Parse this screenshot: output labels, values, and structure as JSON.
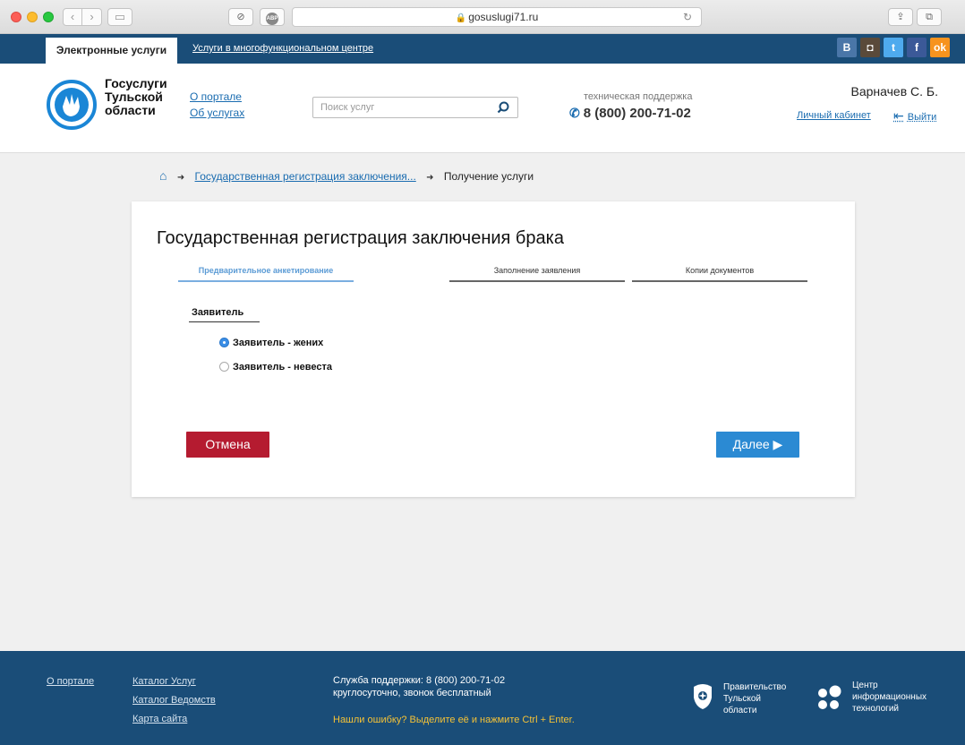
{
  "browser": {
    "url": "gosuslugi71.ru",
    "abp_label": "ABP"
  },
  "topnav": {
    "active_tab": "Электронные услуги",
    "other_tab": "Услуги в многофункциональном центре",
    "social": [
      "В",
      "◘",
      "t",
      "f",
      "ok"
    ]
  },
  "header": {
    "logo_lines": [
      "Госуслуги",
      "Тульской",
      "области"
    ],
    "about_link": "О портале",
    "services_link": "Об услугах",
    "search_placeholder": "Поиск услуг",
    "support_label": "техническая поддержка",
    "support_phone": "8 (800) 200-71-02",
    "username": "Варначев С. Б.",
    "cabinet_link": "Личный кабинет",
    "logout_label": "Выйти"
  },
  "breadcrumb": {
    "sep": "➜",
    "parent": "Государственная регистрация заключения...",
    "current": "Получение услуги"
  },
  "form": {
    "title": "Государственная регистрация заключения брака",
    "steps": [
      "Предварительное анкетирование",
      "Заполнение заявления",
      "Копии документов"
    ],
    "active_step": 0,
    "section_label": "Заявитель",
    "options": [
      {
        "label": "Заявитель - жених",
        "checked": true
      },
      {
        "label": "Заявитель - невеста",
        "checked": false
      }
    ],
    "cancel_label": "Отмена",
    "next_label": "Далее ▶"
  },
  "footer": {
    "about": "О портале",
    "catalog_services": "Каталог Услуг",
    "catalog_agencies": "Каталог Ведомств",
    "sitemap": "Карта сайта",
    "support_line1": "Служба поддержки: 8 (800) 200-71-02",
    "support_line2": "круглосуточно, звонок бесплатный",
    "error_hint": "Нашли ошибку? Выделите её и нажмите Ctrl + Enter.",
    "gov_lines": [
      "Правительство",
      "Тульской",
      "области"
    ],
    "cit_lines": [
      "Центр",
      "информационных",
      "технологий"
    ]
  },
  "colors": {
    "brand_blue": "#1a4d78",
    "link_blue": "#1a6cb0",
    "cancel_red": "#b51b30",
    "next_blue": "#2b8ad3",
    "footer_highlight": "#f5c236"
  }
}
